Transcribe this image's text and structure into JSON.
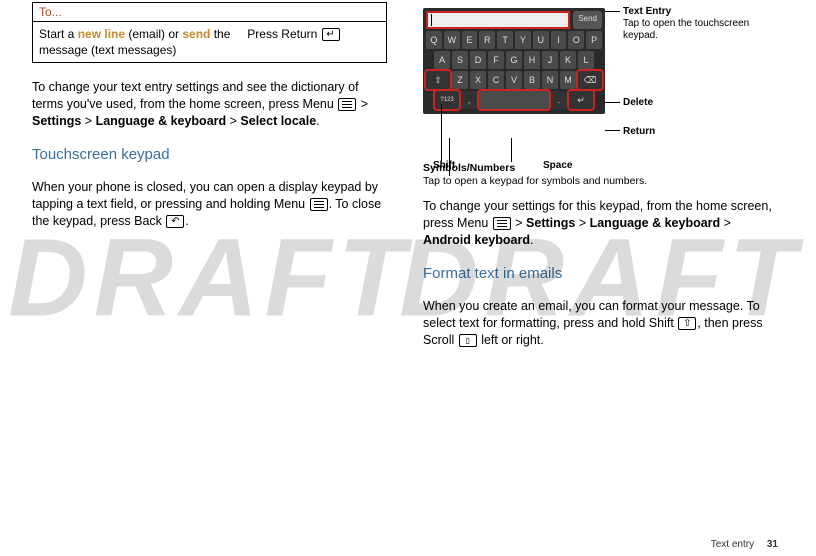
{
  "left": {
    "table": {
      "header": "To...",
      "action_prefix": "Start a ",
      "new_line": "new line",
      "action_mid": " (email) or ",
      "send": "send",
      "action_suffix": " the message (text messages)",
      "result": "Press Return "
    },
    "para1_a": "To change your text entry settings and see the dictionary of terms you've used, from the home screen, press Menu ",
    "para1_b": " > ",
    "settings": "Settings",
    "para1_c": " > ",
    "lang_kb": "Language & keyboard",
    "para1_d": " > ",
    "select_locale": "Select locale",
    "period": ".",
    "section1": "Touchscreen keypad",
    "para2_a": "When your phone is closed, you can open a display keypad by tapping a text field, or pressing and holding Menu ",
    "para2_b": ". To close the keypad, press Back ",
    "para2_c": "."
  },
  "right": {
    "keypad": {
      "send": "Send",
      "row1": [
        "Q",
        "W",
        "E",
        "R",
        "T",
        "Y",
        "U",
        "I",
        "O",
        "P"
      ],
      "row2": [
        "A",
        "S",
        "D",
        "F",
        "G",
        "H",
        "J",
        "K",
        "L"
      ],
      "row3_shift": "⇧",
      "row3": [
        "Z",
        "X",
        "C",
        "V",
        "B",
        "N",
        "M"
      ],
      "row3_del": "⌫",
      "row4_sym": "?123",
      "row4_comma": ",",
      "row4_dot": ".",
      "row4_ret": "↵"
    },
    "callouts": {
      "text_entry_title": "Text Entry",
      "text_entry_sub": "Tap to open the touchscreen keypad.",
      "delete": "Delete",
      "return": "Return",
      "shift": "Shift",
      "space": "Space",
      "symbols_title": "Symbols/Numbers",
      "symbols_sub": "Tap to open a keypad for symbols and numbers."
    },
    "para1_a": "To change your settings for this keypad, from the home screen, press Menu ",
    "para1_b": " > ",
    "settings": "Settings",
    "para1_c": " > ",
    "lang_kb": "Language & keyboard",
    "para1_d": " > ",
    "android_kb": "Android keyboard",
    "period": ".",
    "section2": "Format text in emails",
    "para2_a": "When you create an email, you can format your message. To select text for formatting, press and hold Shift ",
    "para2_b": ", then press Scroll ",
    "para2_c": " left or right."
  },
  "footer": {
    "label": "Text entry",
    "page": "31"
  }
}
